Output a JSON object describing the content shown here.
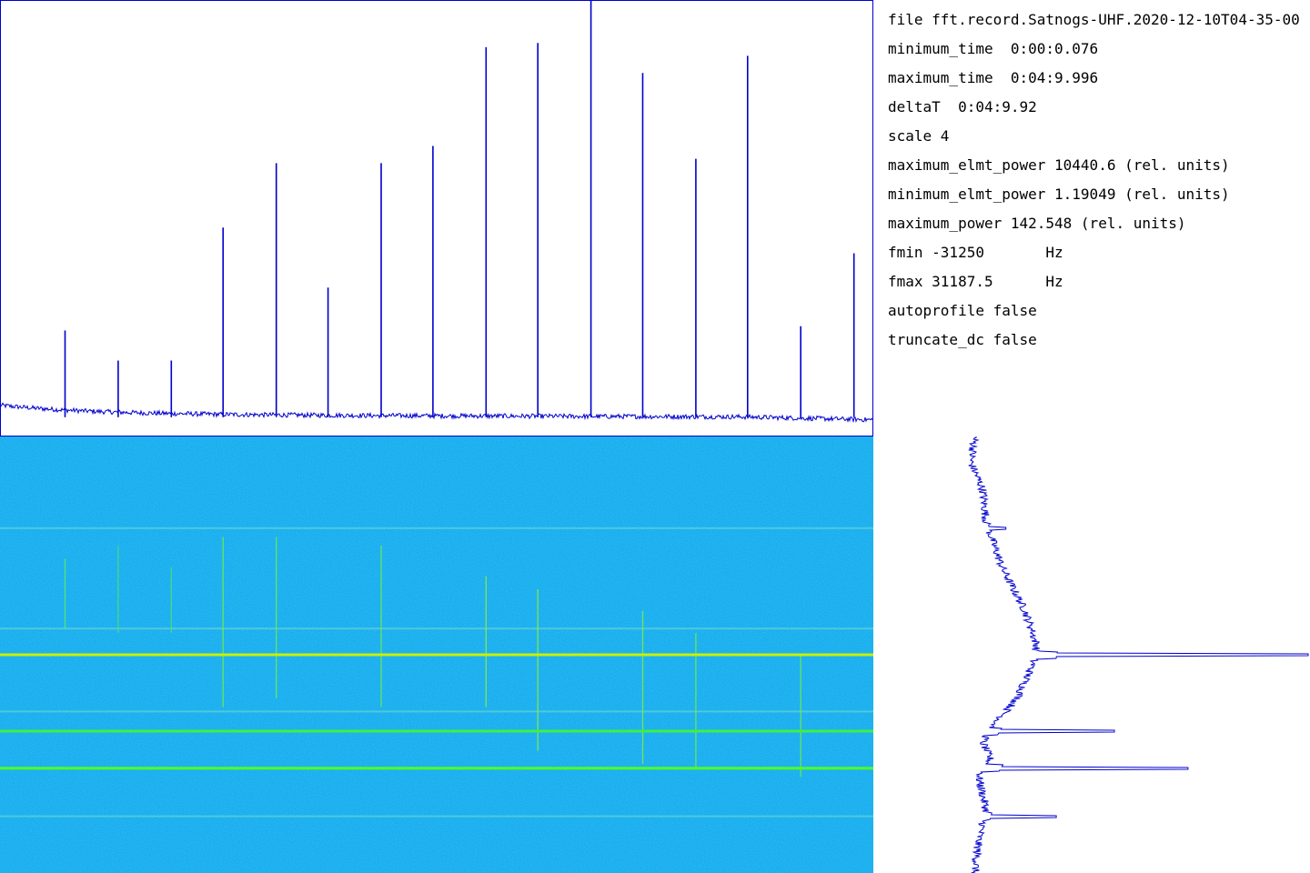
{
  "info": {
    "file": "file fft.record.Satnogs-UHF.2020-12-10T04-35-00",
    "minimum_time": "minimum_time  0:00:0.076",
    "maximum_time": "maximum_time  0:04:9.996",
    "deltaT": "deltaT  0:04:9.92",
    "scale": "scale 4",
    "maximum_elmt_power": "maximum_elmt_power 10440.6 (rel. units)",
    "minimum_elmt_power": "minimum_elmt_power 1.19049 (rel. units)",
    "maximum_power": "maximum_power 142.548 (rel. units)",
    "fmin": "fmin -31250       Hz",
    "fmax": "fmax 31187.5      Hz",
    "autoprofile": "autoprofile false",
    "truncate_dc": "truncate_dc false"
  },
  "chart_data": [
    {
      "type": "line",
      "name": "spectrum",
      "x_range": [
        -31250,
        31187.5
      ],
      "y_range": [
        0,
        100
      ],
      "noise_floor": 2.8,
      "peaks": [
        {
          "freq": -26600,
          "value": 23
        },
        {
          "freq": -22800,
          "value": 16
        },
        {
          "freq": -19000,
          "value": 16
        },
        {
          "freq": -15300,
          "value": 47
        },
        {
          "freq": -11500,
          "value": 62
        },
        {
          "freq": -7800,
          "value": 33
        },
        {
          "freq": -4000,
          "value": 62
        },
        {
          "freq": -300,
          "value": 66
        },
        {
          "freq": 3500,
          "value": 89
        },
        {
          "freq": 7200,
          "value": 90
        },
        {
          "freq": 11000,
          "value": 100
        },
        {
          "freq": 14700,
          "value": 83
        },
        {
          "freq": 18500,
          "value": 63
        },
        {
          "freq": 22200,
          "value": 87
        },
        {
          "freq": 26000,
          "value": 24
        },
        {
          "freq": 29800,
          "value": 41
        }
      ],
      "line_color": "#0000cc"
    },
    {
      "type": "heatmap",
      "name": "waterfall",
      "x_range": [
        -31250,
        31187.5
      ],
      "time_range": [
        "0:00:0.076",
        "0:04:9.996"
      ],
      "background_color": "#1eb4ee",
      "strong_rows": [
        {
          "time_fraction": 0.5,
          "color": "#c8f000"
        },
        {
          "time_fraction": 0.675,
          "color": "#40f040"
        },
        {
          "time_fraction": 0.76,
          "color": "#50ff20"
        }
      ],
      "faint_rows": [
        0.21,
        0.44,
        0.63,
        0.87
      ],
      "vertical_traces": [
        {
          "freq": -26600,
          "t0": 0.28,
          "t1": 0.44,
          "color": "#60ee60"
        },
        {
          "freq": -22800,
          "t0": 0.25,
          "t1": 0.45,
          "color": "#50e070"
        },
        {
          "freq": -19000,
          "t0": 0.3,
          "t1": 0.45,
          "color": "#50e070"
        },
        {
          "freq": -15300,
          "t0": 0.23,
          "t1": 0.62,
          "color": "#70f040"
        },
        {
          "freq": -11500,
          "t0": 0.23,
          "t1": 0.6,
          "color": "#70f040"
        },
        {
          "freq": -4000,
          "t0": 0.25,
          "t1": 0.62,
          "color": "#70f040"
        },
        {
          "freq": 3500,
          "t0": 0.32,
          "t1": 0.62,
          "color": "#90f030"
        },
        {
          "freq": 7200,
          "t0": 0.35,
          "t1": 0.72,
          "color": "#90f030"
        },
        {
          "freq": 14700,
          "t0": 0.4,
          "t1": 0.75,
          "color": "#80f040"
        },
        {
          "freq": 18500,
          "t0": 0.45,
          "t1": 0.76,
          "color": "#70f040"
        },
        {
          "freq": 26000,
          "t0": 0.5,
          "t1": 0.78,
          "color": "#70f040"
        }
      ]
    },
    {
      "type": "line",
      "name": "time-profile",
      "time_range": [
        "0:00:0.076",
        "0:04:9.996"
      ],
      "value_range": [
        0,
        100
      ],
      "baseline": [
        [
          0.0,
          14
        ],
        [
          0.06,
          13
        ],
        [
          0.12,
          16
        ],
        [
          0.2,
          17
        ],
        [
          0.3,
          21
        ],
        [
          0.4,
          27
        ],
        [
          0.48,
          30
        ],
        [
          0.52,
          29
        ],
        [
          0.6,
          25
        ],
        [
          0.66,
          19
        ],
        [
          0.7,
          16
        ],
        [
          0.74,
          18
        ],
        [
          0.78,
          15
        ],
        [
          0.86,
          17
        ],
        [
          0.92,
          15
        ],
        [
          1.0,
          14
        ]
      ],
      "spikes": [
        {
          "t": 0.21,
          "value": 22
        },
        {
          "t": 0.38,
          "value": 23
        },
        {
          "t": 0.42,
          "value": 25
        },
        {
          "t": 0.44,
          "value": 27
        },
        {
          "t": 0.5,
          "value": 100
        },
        {
          "t": 0.675,
          "value": 50
        },
        {
          "t": 0.76,
          "value": 69
        },
        {
          "t": 0.87,
          "value": 35
        }
      ],
      "line_color": "#0000cc"
    }
  ]
}
